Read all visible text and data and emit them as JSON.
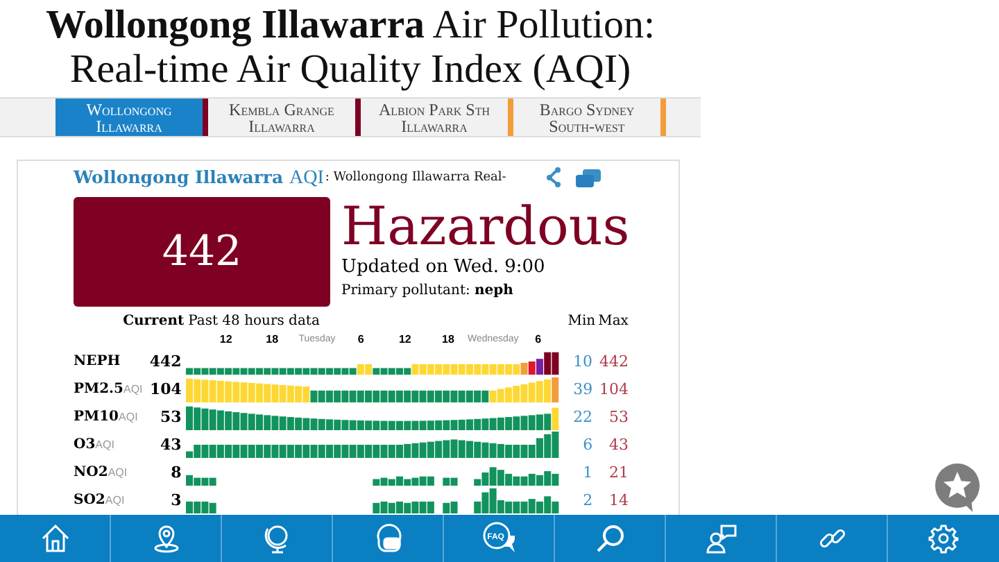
{
  "page_title": "**Wollongong Illawarra** Air Pollution: Real-time Air Quality Index (AQI)",
  "station_tabs": [
    {
      "lines": [
        "Wollongong",
        "Illawarra"
      ],
      "selected": true,
      "color": "#7e0023"
    },
    {
      "lines": [
        "Kembla Grange",
        "Illawarra"
      ],
      "selected": false,
      "color": "#7e0023"
    },
    {
      "lines": [
        "Albion Park Sth",
        "Illawarra"
      ],
      "selected": false,
      "color": "#f39c3c"
    },
    {
      "lines": [
        "Bargo Sydney",
        "South-west"
      ],
      "selected": false,
      "color": "#f39c3c"
    }
  ],
  "card": {
    "station": "Wollongong Illawarra",
    "aqi_label": "AQI",
    "subtitle": ": Wollongong Illawarra Real-",
    "aqi": "442",
    "color": "#7e0023",
    "level_text": "Hazardous",
    "updated": "Updated on Wed. 9:00",
    "primary": "Primary pollutant: **neph**"
  },
  "table": {
    "current_header": "Current",
    "history_header": "Past 48 hours data",
    "min_header": "Min",
    "max_header": "Max",
    "time_labels": [
      "12",
      "18",
      "Tuesday",
      "6",
      "12",
      "18",
      "Wednesday",
      "6"
    ],
    "rows": [
      {
        "name": "NEPH",
        "value": "442",
        "min": "10",
        "max": "442"
      },
      {
        "name": "PM2.5",
        "unit": "AQI",
        "value": "104",
        "min": "39",
        "max": "104"
      },
      {
        "name": "PM10",
        "unit": "AQI",
        "value": "53",
        "min": "22",
        "max": "53"
      },
      {
        "name": "O3",
        "unit": "AQI",
        "value": "43",
        "min": "6",
        "max": "43"
      },
      {
        "name": "NO2",
        "unit": "AQI",
        "value": "8",
        "min": "1",
        "max": "21"
      },
      {
        "name": "SO2",
        "unit": "AQI",
        "value": "3",
        "min": "2",
        "max": "14"
      }
    ]
  },
  "nav": {
    "faq_label": "FAQ"
  }
}
